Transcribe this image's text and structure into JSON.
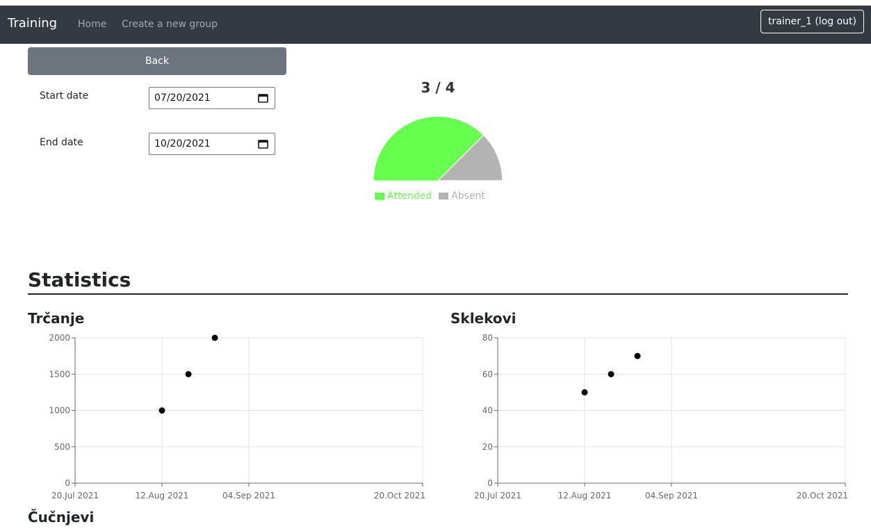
{
  "navbar": {
    "brand": "Training",
    "links": [
      "Home",
      "Create a new group"
    ],
    "user_button": "trainer_1 (log out)"
  },
  "form": {
    "back_label": "Back",
    "start_label": "Start date",
    "start_value": "07/20/2021",
    "end_label": "End date",
    "end_value": "10/20/2021"
  },
  "attendance": {
    "title": "3 / 4",
    "attended": 3,
    "total": 4,
    "legend": [
      "Attended",
      "Absent"
    ],
    "colors": {
      "attended": "#66ff4d",
      "absent": "#b3b3b3"
    }
  },
  "statistics": {
    "title": "Statistics"
  },
  "chart_data": [
    {
      "type": "scatter",
      "title": "Trčanje",
      "x_ticks": [
        "20.Jul 2021",
        "12.Aug 2021",
        "04.Sep 2021",
        "20.Oct 2021"
      ],
      "x_domain": [
        "2021-07-20",
        "2021-10-20"
      ],
      "y_ticks": [
        0,
        500,
        1000,
        1500,
        2000
      ],
      "ylim": [
        0,
        2000
      ],
      "points": [
        {
          "x": "2021-08-12",
          "y": 1000
        },
        {
          "x": "2021-08-19",
          "y": 1500
        },
        {
          "x": "2021-08-26",
          "y": 2000
        }
      ],
      "grid": true
    },
    {
      "type": "scatter",
      "title": "Sklekovi",
      "x_ticks": [
        "20.Jul 2021",
        "12.Aug 2021",
        "04.Sep 2021",
        "20.Oct 2021"
      ],
      "x_domain": [
        "2021-07-20",
        "2021-10-20"
      ],
      "y_ticks": [
        0,
        20,
        40,
        60,
        80
      ],
      "ylim": [
        0,
        80
      ],
      "points": [
        {
          "x": "2021-08-12",
          "y": 50
        },
        {
          "x": "2021-08-19",
          "y": 60
        },
        {
          "x": "2021-08-26",
          "y": 70
        }
      ],
      "grid": true
    }
  ],
  "next_chart_title": "Čučnjevi"
}
